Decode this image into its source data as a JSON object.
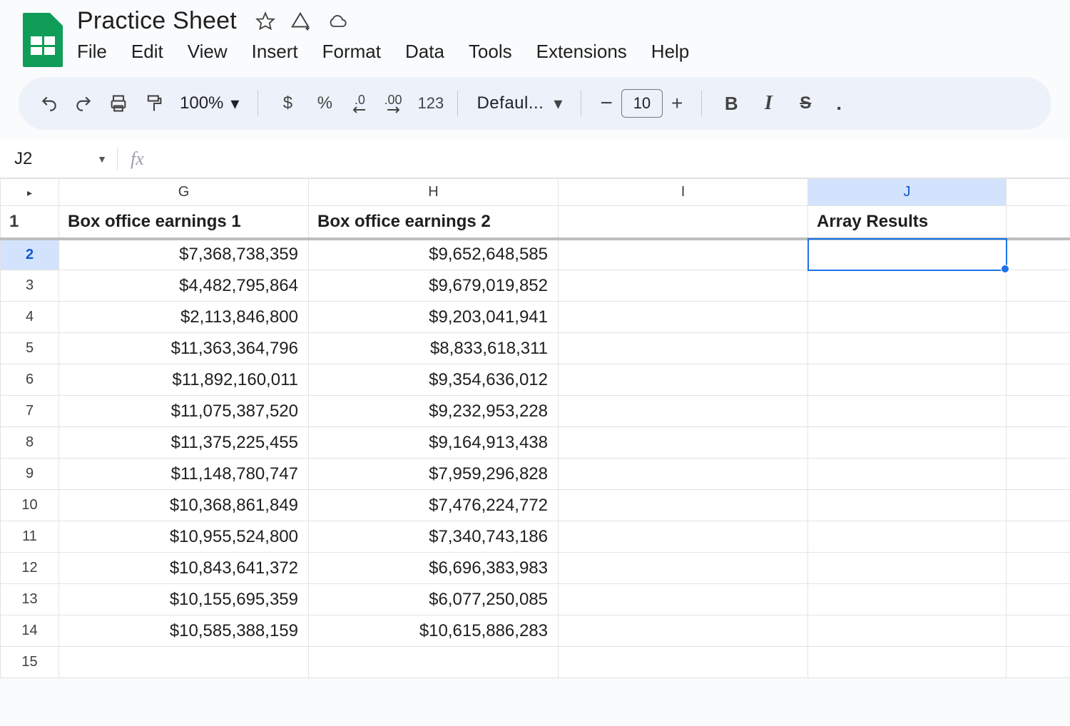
{
  "doc": {
    "title": "Practice Sheet"
  },
  "menus": {
    "file": "File",
    "edit": "Edit",
    "view": "View",
    "insert": "Insert",
    "format": "Format",
    "data": "Data",
    "tools": "Tools",
    "extensions": "Extensions",
    "help": "Help"
  },
  "toolbar": {
    "zoom": "100%",
    "currency": "$",
    "percent": "%",
    "dec_dec": ".0",
    "inc_dec": ".00",
    "num_fmt": "123",
    "font": "Defaul...",
    "font_size": "10",
    "bold": "B",
    "italic": "I",
    "strike": "S"
  },
  "namebox": {
    "ref": "J2"
  },
  "fx": {
    "label": "fx",
    "value": ""
  },
  "columns": {
    "g": "G",
    "h": "H",
    "i": "I",
    "j": "J"
  },
  "headers": {
    "g": "Box office earnings 1",
    "h": "Box office earnings 2",
    "i": "",
    "j": "Array Results"
  },
  "rows": [
    {
      "n": "2",
      "g": "$7,368,738,359",
      "h": "$9,652,648,585"
    },
    {
      "n": "3",
      "g": "$4,482,795,864",
      "h": "$9,679,019,852"
    },
    {
      "n": "4",
      "g": "$2,113,846,800",
      "h": "$9,203,041,941"
    },
    {
      "n": "5",
      "g": "$11,363,364,796",
      "h": "$8,833,618,311"
    },
    {
      "n": "6",
      "g": "$11,892,160,011",
      "h": "$9,354,636,012"
    },
    {
      "n": "7",
      "g": "$11,075,387,520",
      "h": "$9,232,953,228"
    },
    {
      "n": "8",
      "g": "$11,375,225,455",
      "h": "$9,164,913,438"
    },
    {
      "n": "9",
      "g": "$11,148,780,747",
      "h": "$7,959,296,828"
    },
    {
      "n": "10",
      "g": "$10,368,861,849",
      "h": "$7,476,224,772"
    },
    {
      "n": "11",
      "g": "$10,955,524,800",
      "h": "$7,340,743,186"
    },
    {
      "n": "12",
      "g": "$10,843,641,372",
      "h": "$6,696,383,983"
    },
    {
      "n": "13",
      "g": "$10,155,695,359",
      "h": "$6,077,250,085"
    },
    {
      "n": "14",
      "g": "$10,585,388,159",
      "h": "$10,615,886,283"
    },
    {
      "n": "15",
      "g": "",
      "h": ""
    }
  ]
}
